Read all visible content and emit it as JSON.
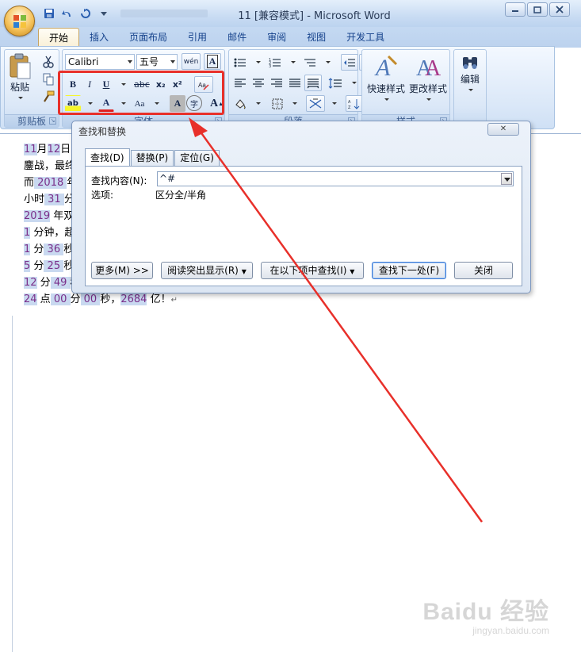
{
  "window": {
    "title": "11 [兼容模式] - Microsoft Word"
  },
  "tabs": [
    "开始",
    "插入",
    "页面布局",
    "引用",
    "邮件",
    "审阅",
    "视图",
    "开发工具"
  ],
  "ribbon": {
    "clipboard": {
      "paste_label": "粘贴",
      "group_label": "剪贴板"
    },
    "font": {
      "font_name": "Calibri",
      "font_size": "五号",
      "phonetic_glyph": "wén",
      "bold": "B",
      "italic": "I",
      "underline": "U",
      "strike": "abc",
      "subscript": "x₂",
      "superscript": "x²",
      "highlight": "ab",
      "font_color": "A",
      "change_case": "Aa",
      "char_shading": "A",
      "enclose": "字",
      "grow": "A",
      "shrink": "A",
      "group_label": "字体"
    },
    "paragraph": {
      "group_label": "段落"
    },
    "styles": {
      "quick_styles": "快速样式",
      "change_styles": "更改样式",
      "group_label": "样式"
    },
    "editing": {
      "label": "编辑"
    }
  },
  "document": {
    "lines": [
      [
        {
          "t": "11",
          "h": true
        },
        {
          "t": "月",
          "h": false
        },
        {
          "t": "12",
          "h": true
        },
        {
          "t": "日",
          "h": false
        }
      ],
      [
        {
          "t": "鏖战，最终",
          "h": false
        }
      ],
      [
        {
          "t": "而",
          "h": false
        },
        {
          "t": " 2018 ",
          "h": true
        },
        {
          "t": "年",
          "h": false
        }
      ],
      [
        {
          "t": "小时",
          "h": false
        },
        {
          "t": " 31 ",
          "h": true
        },
        {
          "t": "分",
          "h": false
        }
      ],
      [
        {
          "t": "2019",
          "h": true
        },
        {
          "t": " 年双",
          "h": false
        }
      ],
      [
        {
          "t": "1",
          "h": true
        },
        {
          "t": " 分钟，超",
          "h": false
        }
      ],
      [
        {
          "t": "1",
          "h": true
        },
        {
          "t": " 分",
          "h": false
        },
        {
          "t": " 36 ",
          "h": true
        },
        {
          "t": "秒",
          "h": false
        }
      ],
      [
        {
          "t": "5",
          "h": true
        },
        {
          "t": " 分",
          "h": false
        },
        {
          "t": " 25 ",
          "h": true
        },
        {
          "t": "秒",
          "h": false
        }
      ],
      [
        {
          "t": "12",
          "h": true
        },
        {
          "t": " 分",
          "h": false
        },
        {
          "t": " 49 ",
          "h": true
        },
        {
          "t": "秒",
          "h": false
        }
      ],
      [
        {
          "t": "24",
          "h": true
        },
        {
          "t": " 点",
          "h": false
        },
        {
          "t": " 00 ",
          "h": true
        },
        {
          "t": "分",
          "h": false
        },
        {
          "t": " 00 ",
          "h": true
        },
        {
          "t": "秒，",
          "h": false
        },
        {
          "t": "2684",
          "h": true
        },
        {
          "t": " 亿！",
          "h": false
        }
      ]
    ],
    "return_mark": "↵"
  },
  "dialog": {
    "title": "查找和替换",
    "tabs": [
      "查找(D)",
      "替换(P)",
      "定位(G)"
    ],
    "find_label": "查找内容(N):",
    "find_value": "^#",
    "options_label": "选项:",
    "options_value": "区分全/半角",
    "buttons": {
      "more": "更多(M) >>",
      "reading_highlight": "阅读突出显示(R)",
      "find_in": "在以下项中查找(I)",
      "find_next": "查找下一处(F)",
      "close": "关闭"
    }
  },
  "watermark": {
    "logo": "Baidu 经验",
    "url": "jingyan.baidu.com"
  },
  "colors": {
    "annotation_red": "#e8302a",
    "highlight": "#c9d9f0"
  }
}
